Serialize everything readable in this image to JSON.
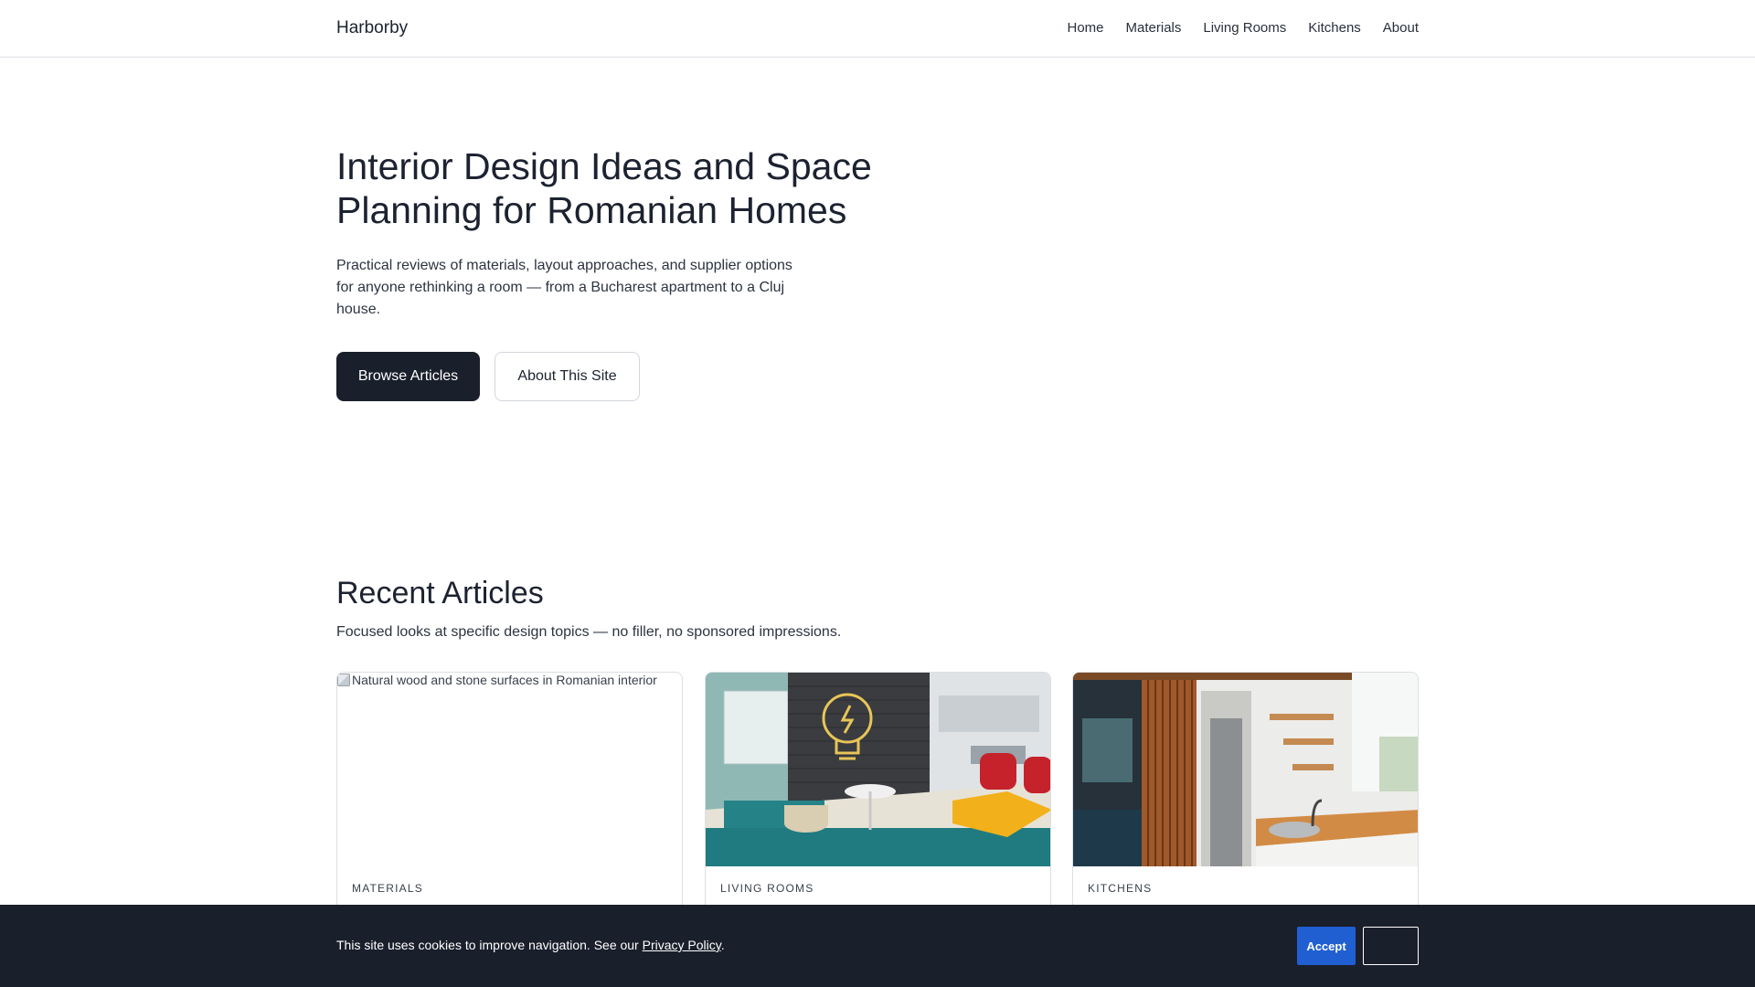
{
  "header": {
    "brand": "Harborby",
    "nav": [
      "Home",
      "Materials",
      "Living Rooms",
      "Kitchens",
      "About"
    ]
  },
  "hero": {
    "title": "Interior Design Ideas and Space Planning for Romanian Homes",
    "subtitle": "Practical reviews of materials, layout approaches, and supplier options for anyone rethinking a room — from a Bucharest apartment to a Cluj house.",
    "primary_button": "Browse Articles",
    "secondary_button": "About This Site"
  },
  "recent": {
    "title": "Recent Articles",
    "subtitle": "Focused looks at specific design topics — no filler, no sponsored impressions.",
    "cards": [
      {
        "category": "MATERIALS",
        "image_alt": "Natural wood and stone surfaces in Romanian interior",
        "image_loaded": false
      },
      {
        "category": "LIVING ROOMS",
        "image_loaded": true
      },
      {
        "category": "KITCHENS",
        "image_loaded": true
      }
    ]
  },
  "cookie": {
    "text": "This site uses cookies to improve navigation. See our ",
    "link": "Privacy Policy",
    "suffix": ".",
    "accept": "Accept",
    "reject": ""
  },
  "colors": {
    "dark": "#1a1f2c",
    "accent_blue": "#1f5fd1",
    "border": "#dcdfe4"
  }
}
